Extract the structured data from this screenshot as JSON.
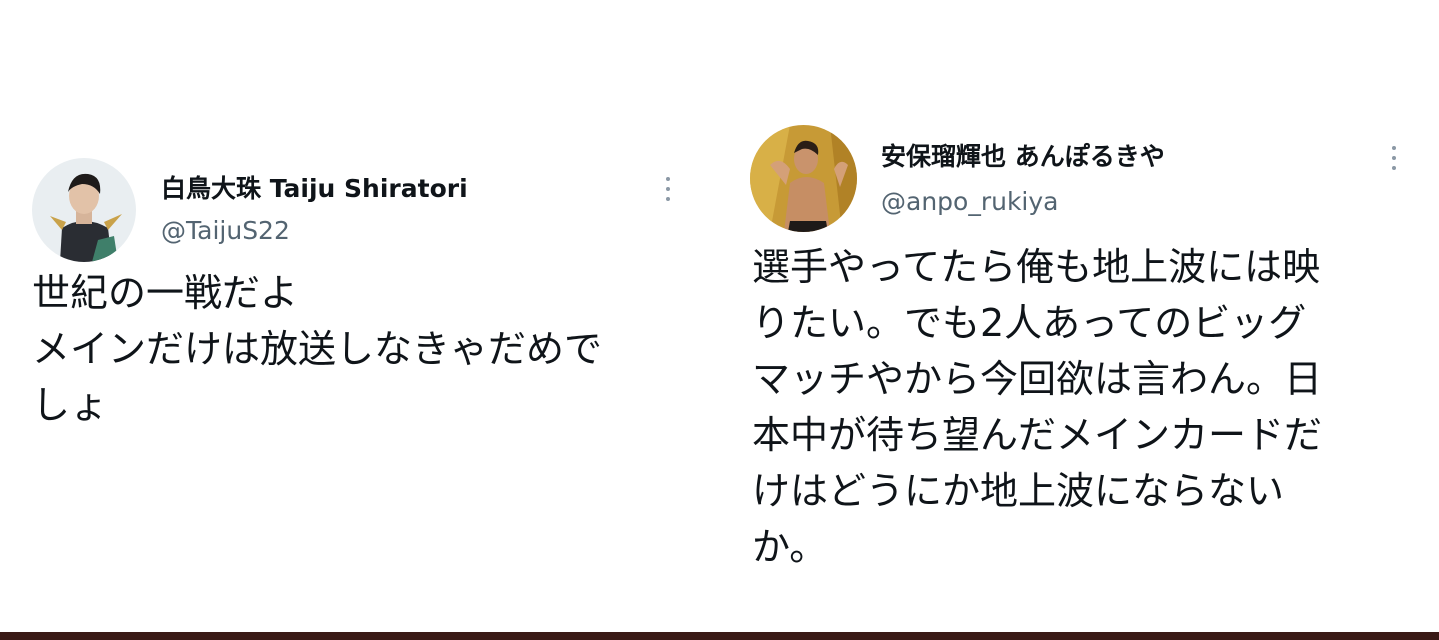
{
  "tweets": [
    {
      "display_name": "白鳥大珠 Taiju Shiratori",
      "handle": "@TaijuS22",
      "text_lines": [
        "世紀の一戦だよ",
        "メインだけは放送しなきゃだめで",
        "しょ"
      ]
    },
    {
      "display_name": "安保瑠輝也 あんぽるきや",
      "handle": "@anpo_rukiya",
      "text_lines": [
        "選手やってたら俺も地上波には映",
        "りたい。でも2人あってのビッグ",
        "マッチやから今回欲は言わん。日",
        "本中が待ち望んだメインカードだ",
        "けはどうにか地上波にならない",
        "か。"
      ]
    }
  ],
  "icons": {
    "more": "more-vertical-icon"
  },
  "colors": {
    "text": "#0f1419",
    "handle": "#536471",
    "more_dots": "#8b98a5",
    "background": "#ffffff",
    "bottom_bar": "#3a1a16"
  }
}
